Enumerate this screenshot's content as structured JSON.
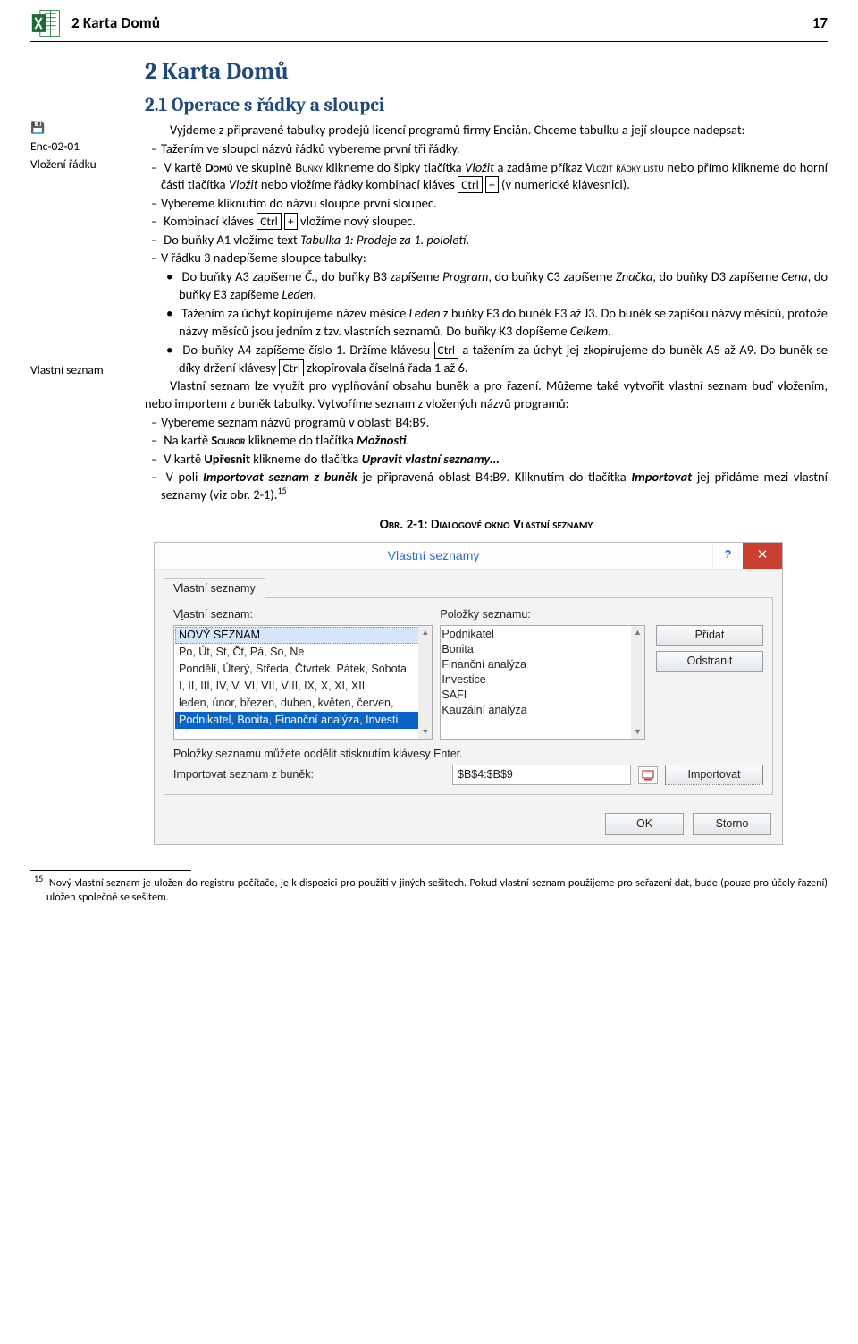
{
  "header": {
    "chapter_title": "2 Karta Domů",
    "page_number": "17"
  },
  "margin": {
    "disk_glyph": "💾",
    "note1_line1": "Enc-02-01",
    "note1_line2": "Vložení řádku",
    "note2": "Vlastní seznam"
  },
  "headings": {
    "h1": "2  Karta Domů",
    "h2": "2.1  Operace s řádky a sloupci"
  },
  "body": {
    "p1a": "Vyjdeme z připravené tabulky prodejů licencí programů firmy Encián. Chceme tabulku a její sloupce nadepsat:",
    "b1": "Tažením ve sloupci názvů řádků vybereme první tři řádky.",
    "b2a": "V kartě ",
    "b2b": "Domů",
    "b2c": " ve skupině ",
    "b2d": "Buňky",
    "b2e": " klikneme do šipky tlačítka ",
    "b2f": "Vložit",
    "b2g": " a zadáme příkaz ",
    "b2h": "Vložit řádky listu",
    "b2i": " nebo přímo klikneme do horní části tlačítka ",
    "b2j": "Vložit",
    "b2k": " nebo vložíme řádky kombinací kláves ",
    "b2l": "Ctrl",
    "b2m": "+",
    "b2n": " (v numerické klávesnici).",
    "b3": "Vybereme kliknutím do názvu sloupce první sloupec.",
    "b4a": "Kombinací kláves ",
    "b4b": "Ctrl",
    "b4c": "+",
    "b4d": " vložíme nový sloupec.",
    "b5a": "Do buňky A1 vložíme text ",
    "b5b": "Tabulka 1: Prodeje za 1. pololetí",
    "b5c": ".",
    "b6": "V řádku 3 nadepíšeme sloupce tabulky:",
    "c1a": "Do buňky A3 zapíšeme ",
    "c1b": "Č.",
    "c1c": ", do buňky B3 zapíšeme ",
    "c1d": "Program",
    "c1e": ", do buňky C3 zapíšeme ",
    "c1f": "Značka",
    "c1g": ", do buňky D3 zapíšeme ",
    "c1h": "Cena",
    "c1i": ", do buňky E3 zapíšeme ",
    "c1j": "Leden",
    "c1k": ".",
    "c2a": "Tažením za úchyt kopírujeme název měsíce ",
    "c2b": "Leden",
    "c2c": " z buňky E3 do buněk F3 až J3. Do buněk se zapíšou názvy měsíců, protože názvy měsíců jsou jedním z tzv. vlastních seznamů. Do buňky K3 dopíšeme ",
    "c2d": "Celkem",
    "c2e": ".",
    "c3a": "Do buňky A4 zapíšeme číslo 1. Držíme klávesu ",
    "c3b": "Ctrl",
    "c3c": " a tažením za úchyt jej zkopírujeme do buněk A5 až A9. Do buněk se díky držení klávesy ",
    "c3d": "Ctrl",
    "c3e": " zkopírovala číselná řada 1 až 6.",
    "p2": "Vlastní seznam lze využít pro vyplňování obsahu buněk a pro řazení. Můžeme také vytvořit vlastní seznam buď vložením, nebo importem z buněk tabulky. Vytvoříme seznam z vložených názvů programů:",
    "b7": "Vybereme seznam názvů programů v oblasti B4:B9.",
    "b8a": "Na kartě ",
    "b8b": "Soubor",
    "b8c": " klikneme do tlačítka ",
    "b8d": "Možnosti",
    "b8e": ".",
    "b9a": "V kartě ",
    "b9b": "Upřesnit",
    "b9c": " klikneme do tlačítka ",
    "b9d": "Upravit vlastní seznamy…",
    "b10a": "V poli ",
    "b10b": "Importovat seznam z buněk",
    "b10c": " je připravená oblast B4:B9. Kliknutím do tlačítka ",
    "b10d": "Importovat",
    "b10e": " jej přidáme mezi vlastní seznamy (viz obr. 2-1).",
    "b10sup": "15"
  },
  "figure": {
    "caption": "Obr. 2-1: Dialogové okno Vlastní seznamy"
  },
  "dialog": {
    "title": "Vlastní seznamy",
    "help": "?",
    "close": "✕",
    "tab": "Vlastní seznamy",
    "left_label_pre": "V",
    "left_label_u": "l",
    "left_label_post": "astní seznam:",
    "right_label_pre": "Polo",
    "right_label_u": "ž",
    "right_label_post": "ky seznamu:",
    "left_items": [
      "NOVÝ SEZNAM",
      "Po, Út, St, Čt, Pá, So, Ne",
      "Pondělí, Úterý, Středa, Čtvrtek, Pátek, Sobota",
      "I, II, III, IV, V, VI, VII, VIII, IX, X, XI, XII",
      "leden, únor, březen, duben, květen, červen,",
      "Podnikatel, Bonita, Finanční analýza, Investi"
    ],
    "right_items": [
      "Podnikatel",
      "Bonita",
      "Finanční analýza",
      "Investice",
      "SAFI",
      "Kauzální analýza"
    ],
    "btn_add": "Přidat",
    "btn_del": "Odstranit",
    "hint": "Položky seznamu můžete oddělit stisknutím klávesy Enter.",
    "import_label": "Importovat seznam z buněk:",
    "import_value": "$B$4:$B$9",
    "btn_import": "Importovat",
    "btn_ok": "OK",
    "btn_cancel": "Storno"
  },
  "footnote": {
    "num": "15",
    "text": "Nový vlastní seznam je uložen do registru počítače, je k dispozici pro použití v jiných sešitech. Pokud vlastní seznam použijeme pro seřazení dat, bude (pouze pro účely řazení) uložen společně se sešitem."
  }
}
